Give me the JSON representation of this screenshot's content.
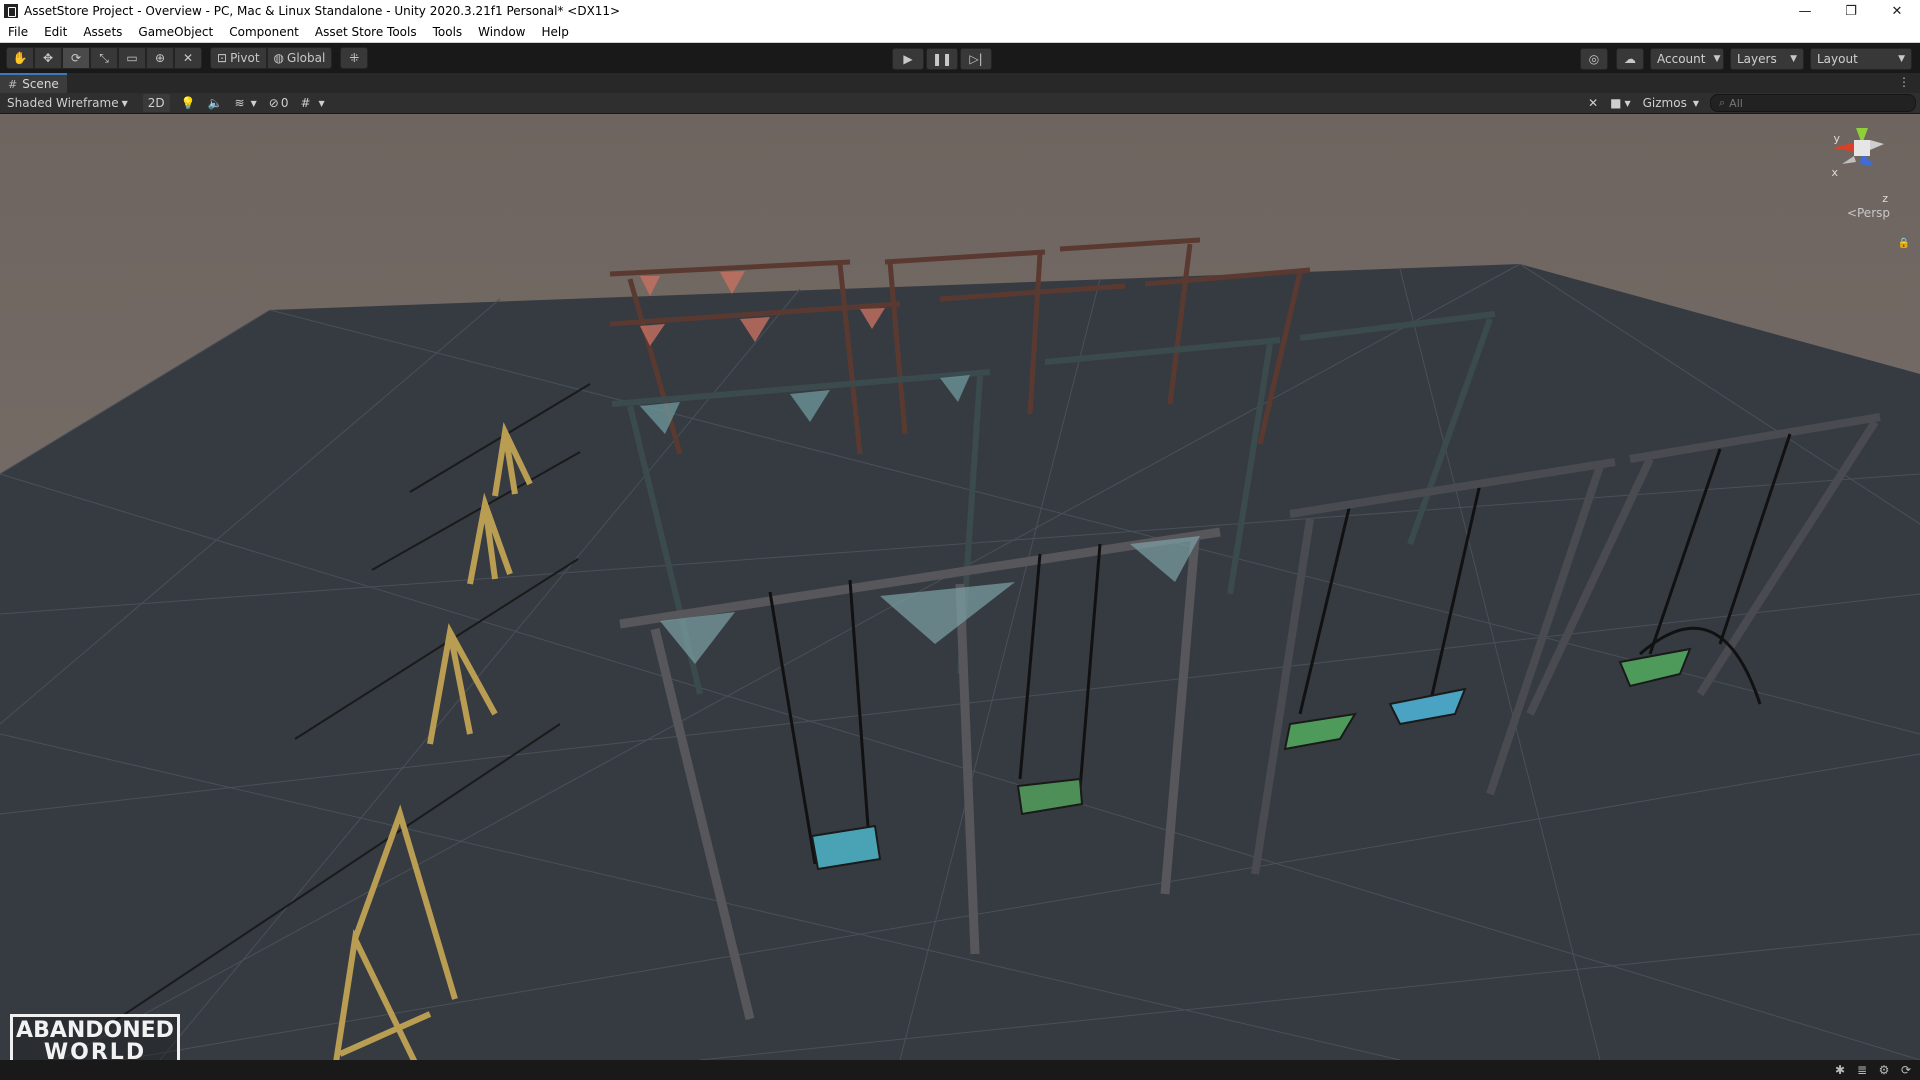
{
  "window": {
    "title": "AssetStore Project - Overview - PC, Mac & Linux Standalone - Unity 2020.3.21f1 Personal* <DX11>",
    "minimize": "—",
    "maximize": "❐",
    "close": "✕"
  },
  "menu": [
    "File",
    "Edit",
    "Assets",
    "GameObject",
    "Component",
    "Asset Store Tools",
    "Tools",
    "Window",
    "Help"
  ],
  "toolbar": {
    "tools": [
      "hand-tool-icon",
      "move-tool-icon",
      "rotate-tool-icon",
      "scale-tool-icon",
      "rect-tool-icon",
      "transform-tool-icon",
      "custom-tool-icon"
    ],
    "active_tool": "rotate-tool-icon",
    "pivot_label": "Pivot",
    "global_label": "Global",
    "account_label": "Account",
    "layers_label": "Layers",
    "layout_label": "Layout"
  },
  "scene_tab": {
    "label": "Scene"
  },
  "scene_toolbar": {
    "draw_mode": "Shaded Wireframe",
    "mode_2d": "2D",
    "hidden_count": "0",
    "gizmos_label": "Gizmos",
    "search_placeholder": "All"
  },
  "orientation_gizmo": {
    "x_label": "x",
    "y_label": "y",
    "z_label": "z",
    "projection": "Persp"
  },
  "watermark": {
    "line1": "ABANDONED",
    "line2": "WORLD"
  },
  "colors": {
    "sky": "#766a63",
    "floor": "#363b42",
    "accent_tab": "#3a79bb"
  }
}
